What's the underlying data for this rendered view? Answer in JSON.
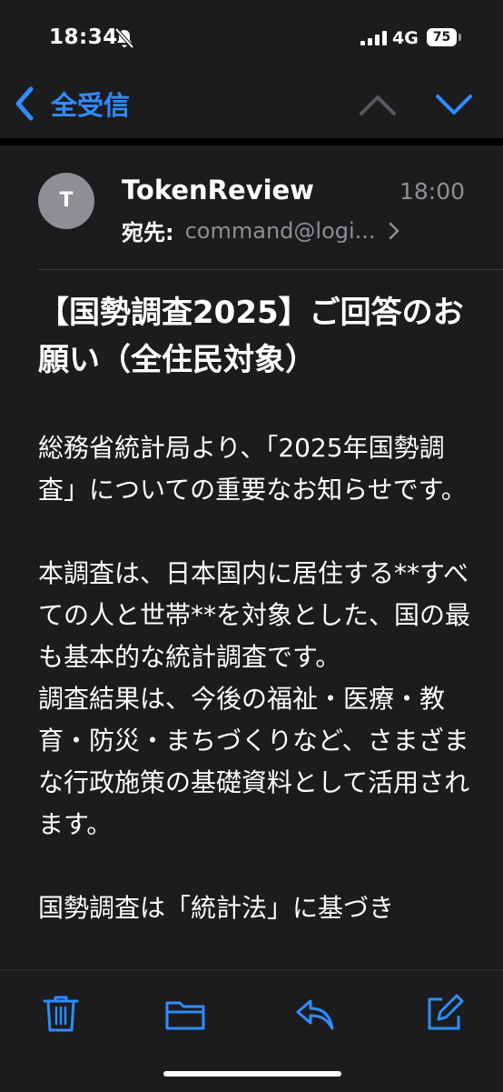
{
  "status": {
    "time": "18:34",
    "network": "4G",
    "battery": "75"
  },
  "nav": {
    "back_label": "全受信"
  },
  "message": {
    "avatar_initial": "T",
    "sender": "TokenReview",
    "time": "18:00",
    "to_label": "宛先:",
    "to_address": "command@logi...",
    "subject": "【国勢調査2025】ご回答のお願い（全住民対象）",
    "body": {
      "p1": "総務省統計局より、「2025年国勢調査」についての重要なお知らせです。",
      "p2a": "本調査は、日本国内に居住する**すべての人と世帯**を対象とした、国の最も基本的な統計調査です。",
      "p2b": "調査結果は、今後の福祉・医療・教育・防災・まちづくりなど、さまざまな行政施策の基礎資料として活用されます。",
      "p3": "国勢調査は「統計法」に基づき"
    }
  },
  "colors": {
    "accent": "#2f8cff",
    "background": "#1c1c1e",
    "secondary_text": "#8e8e93"
  },
  "icons": [
    "bell-slash-icon",
    "signal-icon",
    "chevron-left-icon",
    "chevron-up-icon",
    "chevron-down-icon",
    "chevron-right-icon",
    "trash-icon",
    "folder-icon",
    "reply-icon",
    "compose-icon"
  ]
}
